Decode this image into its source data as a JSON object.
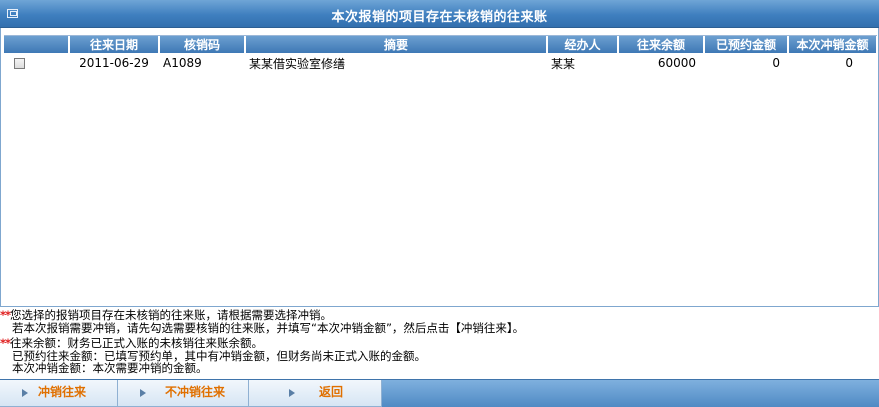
{
  "window": {
    "title": "本次报销的项目存在未核销的往来账"
  },
  "grid": {
    "columns": [
      "往来日期",
      "核销码",
      "摘要",
      "经办人",
      "往来余额",
      "已预约金额",
      "本次冲销金额"
    ],
    "rows": [
      {
        "checked": false,
        "date": "2011-06-29",
        "code": "A1089",
        "summary": "某某借实验室修缮",
        "handler": "某某",
        "balance": "60000",
        "reserved": "0",
        "writeoff": "0"
      }
    ]
  },
  "notes": {
    "stars": "**",
    "line1": "您选择的报销项目存在未核销的往来账，请根据需要选择冲销。",
    "line2": "若本次报销需要冲销，请先勾选需要核销的往来账，并填写“本次冲销金额”，然后点击【冲销往来】。",
    "line3": "往来余额：财务已正式入账的未核销往来账余额。",
    "line4": "已预约往来金额：已填写预约单，其中有冲销金额，但财务尚未正式入账的金额。",
    "line5": "本次冲销金额：本次需要冲销的金额。"
  },
  "footer": {
    "buttons": [
      "冲销往来",
      "不冲销往来",
      "返回"
    ]
  },
  "colors": {
    "accent": "#3f7fbf",
    "button_text": "#e07000",
    "star": "#e02020"
  }
}
